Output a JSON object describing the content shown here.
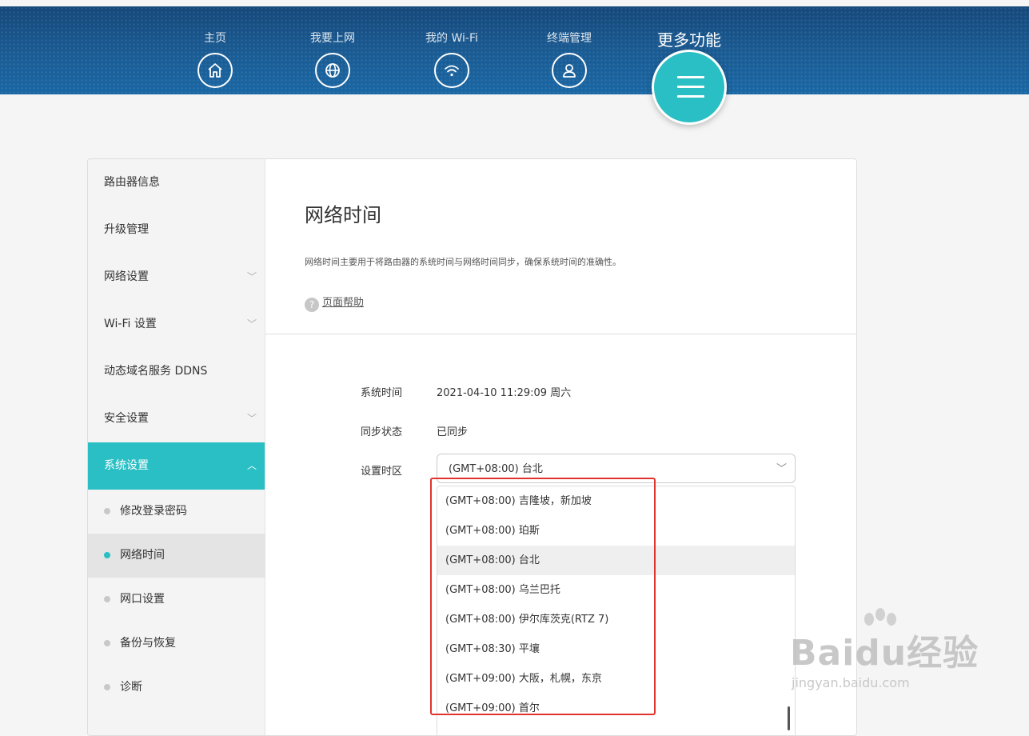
{
  "nav": {
    "items": [
      {
        "label": "主页",
        "icon": "home-icon"
      },
      {
        "label": "我要上网",
        "icon": "globe-icon"
      },
      {
        "label": "我的 Wi-Fi",
        "icon": "wifi-icon"
      },
      {
        "label": "终端管理",
        "icon": "user-icon"
      }
    ],
    "more_label": "更多功能",
    "more_icon": "menu-icon"
  },
  "sidebar": {
    "items": [
      {
        "label": "路由器信息"
      },
      {
        "label": "升级管理"
      },
      {
        "label": "网络设置"
      },
      {
        "label": "Wi-Fi 设置"
      },
      {
        "label": "动态域名服务 DDNS"
      },
      {
        "label": "安全设置"
      },
      {
        "label": "系统设置"
      }
    ],
    "subitems": [
      {
        "label": "修改登录密码"
      },
      {
        "label": "网络时间"
      },
      {
        "label": "网口设置"
      },
      {
        "label": "备份与恢复"
      },
      {
        "label": "诊断"
      }
    ]
  },
  "main": {
    "title": "网络时间",
    "description": "网络时间主要用于将路由器的系统时间与网络时间同步，确保系统时间的准确性。",
    "help_link": "页面帮助",
    "fields": {
      "system_time_label": "系统时间",
      "system_time_value": "2021-04-10 11:29:09 周六",
      "sync_status_label": "同步状态",
      "sync_status_value": "已同步",
      "timezone_label": "设置时区",
      "timezone_value": "(GMT+08:00) 台北"
    },
    "timezone_options": [
      "(GMT+08:00) 吉隆坡，新加坡",
      "(GMT+08:00) 珀斯",
      "(GMT+08:00) 台北",
      "(GMT+08:00) 乌兰巴托",
      "(GMT+08:00) 伊尔库茨克(RTZ 7)",
      "(GMT+08:30) 平壤",
      "(GMT+09:00) 大阪，札幌，东京",
      "(GMT+09:00) 首尔"
    ]
  },
  "watermark": {
    "logo": "Baidu经验",
    "url": "jingyan.baidu.com"
  },
  "colors": {
    "accent": "#29bfc4",
    "header": "#1a5c94",
    "highlight_box": "#e0332d"
  }
}
